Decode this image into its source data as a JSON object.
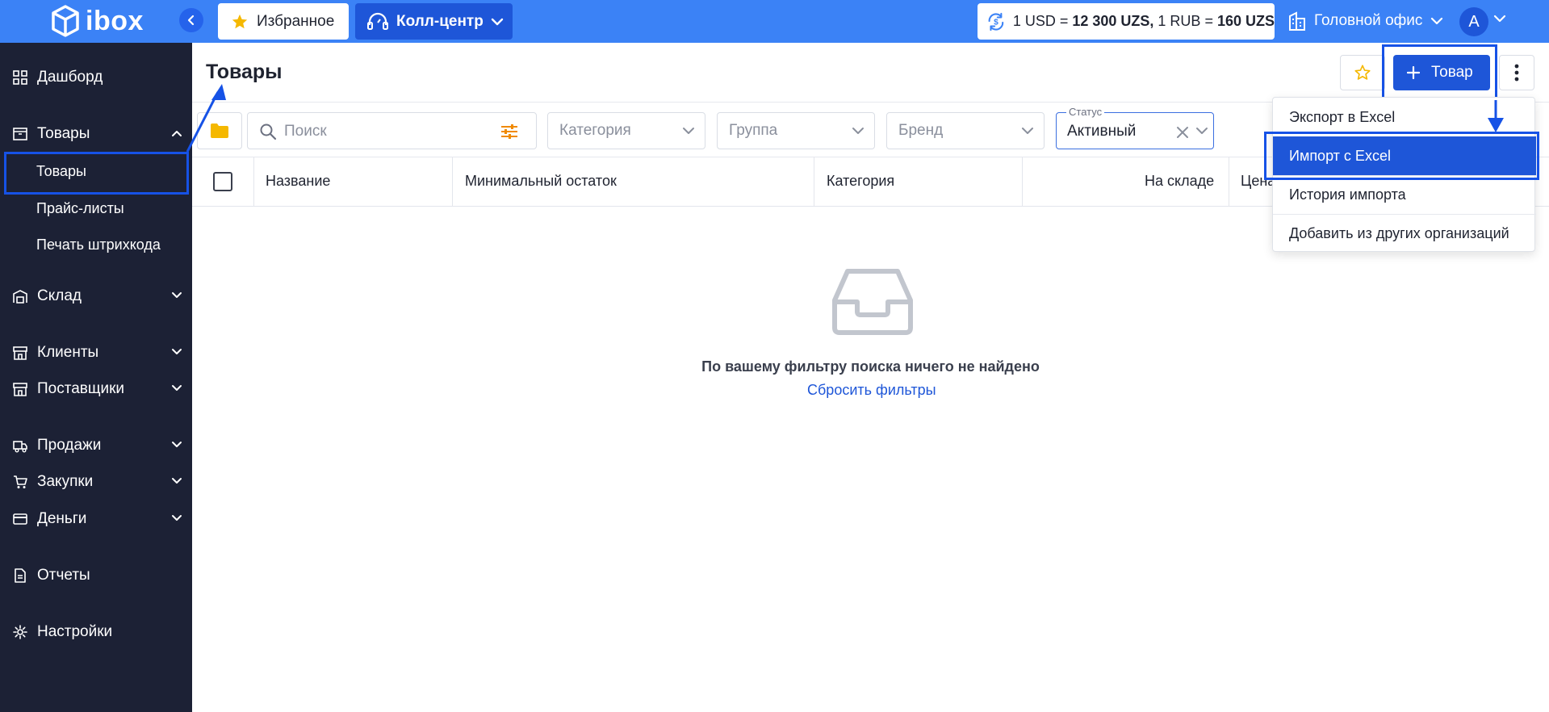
{
  "app": {
    "logo_text": "ibox"
  },
  "topbar": {
    "favorites_label": "Избранное",
    "callcenter_label": "Колл-центр",
    "rates": {
      "usd_prefix": "1 USD = ",
      "usd_value": "12 300 UZS,",
      "rub_prefix": " 1 RUB = ",
      "rub_value": "160 UZS"
    },
    "office_label": "Головной офис",
    "avatar_letter": "A"
  },
  "sidebar": {
    "items": [
      {
        "label": "Дашборд",
        "icon": "grid-icon"
      },
      {
        "label": "Товары",
        "icon": "box-icon"
      },
      {
        "label": "Склад",
        "icon": "warehouse-icon"
      },
      {
        "label": "Клиенты",
        "icon": "store-icon"
      },
      {
        "label": "Поставщики",
        "icon": "store-icon"
      },
      {
        "label": "Продажи",
        "icon": "truck-icon"
      },
      {
        "label": "Закупки",
        "icon": "cart-icon"
      },
      {
        "label": "Деньги",
        "icon": "card-icon"
      },
      {
        "label": "Отчеты",
        "icon": "document-icon"
      },
      {
        "label": "Настройки",
        "icon": "gear-icon"
      }
    ],
    "sub_items": [
      {
        "label": "Товары"
      },
      {
        "label": "Прайс-листы"
      },
      {
        "label": "Печать штрихкода"
      }
    ]
  },
  "main": {
    "title": "Товары",
    "add_button_label": "Товар",
    "filters": {
      "search_placeholder": "Поиск",
      "category_placeholder": "Категория",
      "group_placeholder": "Группа",
      "brand_placeholder": "Бренд",
      "status_legend": "Статус",
      "status_value": "Активный"
    },
    "table": {
      "columns": [
        "Название",
        "Минимальный остаток",
        "Категория",
        "На складе",
        "Цена"
      ]
    },
    "empty": {
      "message": "По вашему фильтру поиска ничего не найдено",
      "reset_link": "Сбросить фильтры"
    }
  },
  "menu": {
    "items": [
      {
        "label": "Экспорт в Excel"
      },
      {
        "label": "Импорт с Excel"
      },
      {
        "label": "История импорта"
      },
      {
        "label": "Добавить из других организаций"
      }
    ],
    "active_index": 1
  },
  "colors": {
    "topbar": "#3b82f6",
    "primary": "#1e56d8",
    "sidebar": "#1c2135",
    "accent_orange": "#f59e0b",
    "annotation": "#1652e6"
  }
}
